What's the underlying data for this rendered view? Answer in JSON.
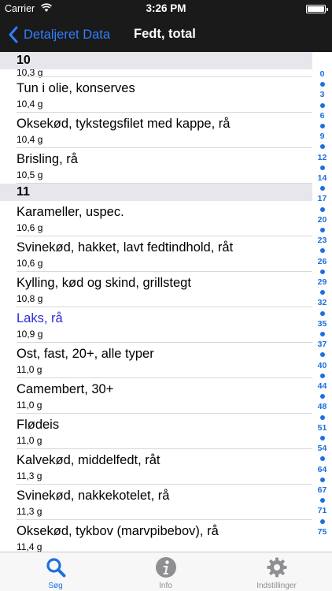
{
  "status_bar": {
    "carrier": "Carrier",
    "time": "3:26 PM"
  },
  "nav": {
    "back_label": "Detaljeret Data",
    "title": "Fedt, total"
  },
  "sticky_header": "10",
  "partial_row_value": "10,3 g",
  "rows_before": [
    {
      "name": "Tun i olie, konserves",
      "value": "10,4 g"
    },
    {
      "name": "Oksekød, tykstegsfilet med kappe, rå",
      "value": "10,4 g"
    },
    {
      "name": "Brisling, rå",
      "value": "10,5 g"
    }
  ],
  "section_11": "11",
  "rows_after": [
    {
      "name": "Karameller, uspec.",
      "value": "10,6 g"
    },
    {
      "name": "Svinekød, hakket, lavt fedtindhold, råt",
      "value": "10,6 g"
    },
    {
      "name": "Kylling, kød og skind, grillstegt",
      "value": "10,8 g"
    },
    {
      "name": "Laks, rå",
      "value": "10,9 g",
      "highlight": true
    },
    {
      "name": "Ost, fast, 20+, alle typer",
      "value": "11,0 g"
    },
    {
      "name": "Camembert, 30+",
      "value": "11,0 g"
    },
    {
      "name": "Flødeis",
      "value": "11,0 g"
    },
    {
      "name": "Kalvekød, middelfedt, råt",
      "value": "11,3 g"
    },
    {
      "name": "Svinekød, nakkekotelet, rå",
      "value": "11,3 g"
    },
    {
      "name": "Oksekød, tykbov (marvpibebov), rå",
      "value": "11,4 g"
    }
  ],
  "index_labels": [
    "0",
    "3",
    "6",
    "9",
    "12",
    "14",
    "17",
    "20",
    "23",
    "26",
    "29",
    "32",
    "35",
    "37",
    "40",
    "44",
    "48",
    "51",
    "54",
    "64",
    "67",
    "71",
    "75"
  ],
  "tabs": [
    {
      "label": "Søg",
      "icon": "search-icon",
      "active": true
    },
    {
      "label": "Info",
      "icon": "info-icon",
      "active": false
    },
    {
      "label": "Indstillinger",
      "icon": "gear-icon",
      "active": false
    }
  ],
  "colors": {
    "accent": "#1e6fe0",
    "highlight_text": "#2b2bd6",
    "bar": "#1a1a1a"
  }
}
